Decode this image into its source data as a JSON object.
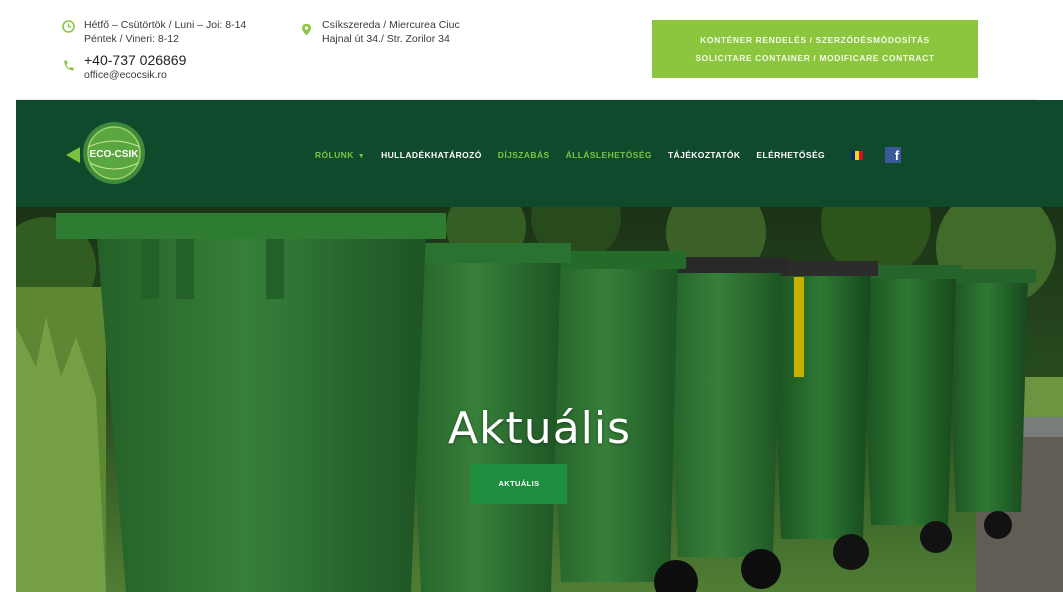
{
  "topbar": {
    "hours_line1": "Hétfő – Csütörtök / Luni – Joi: 8-14",
    "hours_line2": "Péntek / Vineri: 8-12",
    "phone": "+40-737 026869",
    "email": "office@ecocsik.ro",
    "address_line1": "Csíkszereda / Miercurea Ciuc",
    "address_line2": "Hajnal út 34./ Str. Zorilor 34",
    "cta_line1": "KONTÉNER RENDELÉS / SZERZŐDÉSMÓDOSÍTÁS",
    "cta_line2": "SOLICITARE CONTAINER / MODIFICARE CONTRACT",
    "cta_color": "#8cc63f"
  },
  "nav": {
    "logo_text": "ECO-CSIK",
    "items": [
      {
        "label": "RÓLUNK",
        "active": true
      },
      {
        "label": "HULLADÉKHATÁROZÓ",
        "active": false
      },
      {
        "label": "DÍJSZABÁS",
        "active": true
      },
      {
        "label": "ÁLLÁSLEHETŐSÉG",
        "active": true
      },
      {
        "label": "TÁJÉKOZTATÓK",
        "active": false
      },
      {
        "label": "ELÉRHETŐSÉG",
        "active": false
      }
    ],
    "flag_icon": "romania-flag-icon",
    "social_icon": "facebook-icon",
    "background": "#0f4a2c",
    "accent": "#7cc242"
  },
  "hero": {
    "title": "Aktuális",
    "button_label": "AKTUÁLIS",
    "button_color": "#1e8f3e"
  }
}
